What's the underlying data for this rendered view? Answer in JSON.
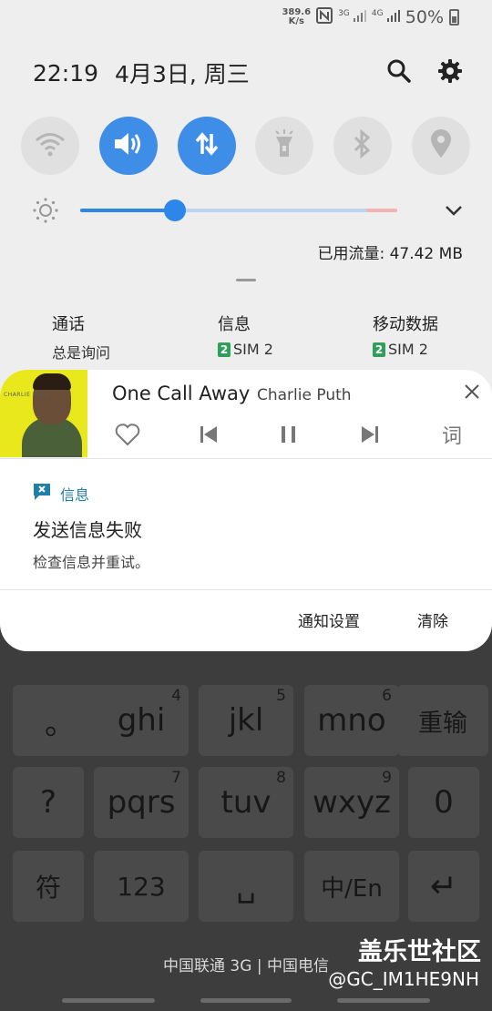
{
  "status_bar": {
    "net_speed_value": "389.6",
    "net_speed_unit": "K/s",
    "network_3g": "3G",
    "network_4g": "4G",
    "battery": "50%"
  },
  "header": {
    "time": "22:19",
    "date": "4月3日, 周三"
  },
  "quick_toggles": [
    {
      "name": "wifi",
      "on": false
    },
    {
      "name": "sound",
      "on": true
    },
    {
      "name": "mobile-data",
      "on": true
    },
    {
      "name": "flashlight",
      "on": false
    },
    {
      "name": "bluetooth",
      "on": false
    },
    {
      "name": "location",
      "on": false
    }
  ],
  "brightness": {
    "level": 0.3
  },
  "data_usage": "已用流量: 47.42 MB",
  "sim_settings": [
    {
      "label": "通话",
      "value": "总是询问",
      "badge": ""
    },
    {
      "label": "信息",
      "value": "SIM 2",
      "badge": "2"
    },
    {
      "label": "移动数据",
      "value": "SIM 2",
      "badge": "2"
    }
  ],
  "media": {
    "title": "One Call Away",
    "artist": "Charlie Puth",
    "album_text": "CHARLIE PUTH",
    "lyrics_label": "词"
  },
  "notification": {
    "app": "信息",
    "title": "发送信息失败",
    "body": "检查信息并重试。"
  },
  "actions": {
    "settings": "通知设置",
    "clear": "清除"
  },
  "keyboard": {
    "row1": [
      {
        "label": "。",
        "num": ""
      },
      {
        "label": "ghi",
        "num": "4"
      },
      {
        "label": "jkl",
        "num": "5"
      },
      {
        "label": "mno",
        "num": "6"
      },
      {
        "label": "重输",
        "num": ""
      }
    ],
    "row2": [
      {
        "label": "?",
        "num": ""
      },
      {
        "label": "pqrs",
        "num": "7"
      },
      {
        "label": "tuv",
        "num": "8"
      },
      {
        "label": "wxyz",
        "num": "9"
      },
      {
        "label": "0",
        "num": ""
      }
    ],
    "row3": [
      {
        "label": "符",
        "num": ""
      },
      {
        "label": "123",
        "num": ""
      },
      {
        "label": "␣",
        "num": ""
      },
      {
        "label": "中/En",
        "num": ""
      },
      {
        "label": "↵",
        "num": ""
      }
    ]
  },
  "carrier": "中国联通 3G | 中国电信",
  "watermark": {
    "line1": "盖乐世社区",
    "line2": "@GC_IM1HE9NH"
  },
  "colors": {
    "accent": "#3e8ee8",
    "sim_badge": "#2f9f5b",
    "app_color": "#1f7fa8"
  }
}
